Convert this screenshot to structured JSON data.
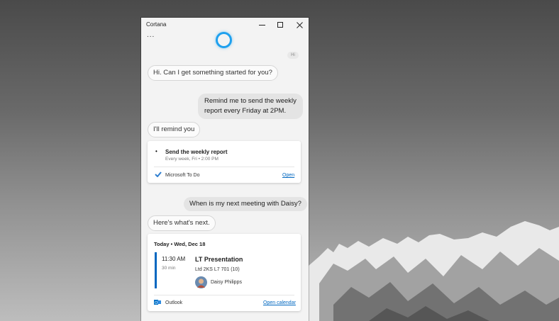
{
  "window": {
    "title": "Cortana",
    "more_label": "...",
    "peek_text": "Hi"
  },
  "chat": {
    "greeting": "Hi. Can I get something started for you?",
    "user_msg_1_line1": "Remind me to send the weekly",
    "user_msg_1_line2": "report every Friday at 2PM.",
    "reply_1": "I'll remind you",
    "user_msg_2": "When is my next meeting with Daisy?",
    "reply_2": "Here's what's next."
  },
  "todo_card": {
    "bullet": "•",
    "task_title": "Send the weekly report",
    "task_detail": "Every week, Fri • 2:00 PM",
    "app_name": "Microsoft To Do",
    "open_label": "Open"
  },
  "calendar_card": {
    "header": "Today • Wed, Dec 18",
    "time": "11:30 AM",
    "duration": "30 min",
    "event_title": "LT Presentation",
    "location": "Ltd 2KS L7 701 (10)",
    "attendee": "Daisy Philipps",
    "app_name": "Outlook",
    "open_label": "Open calendar"
  },
  "colors": {
    "accent": "#1ea0ee",
    "event_bar": "#0067c0",
    "link": "#0067c0"
  }
}
